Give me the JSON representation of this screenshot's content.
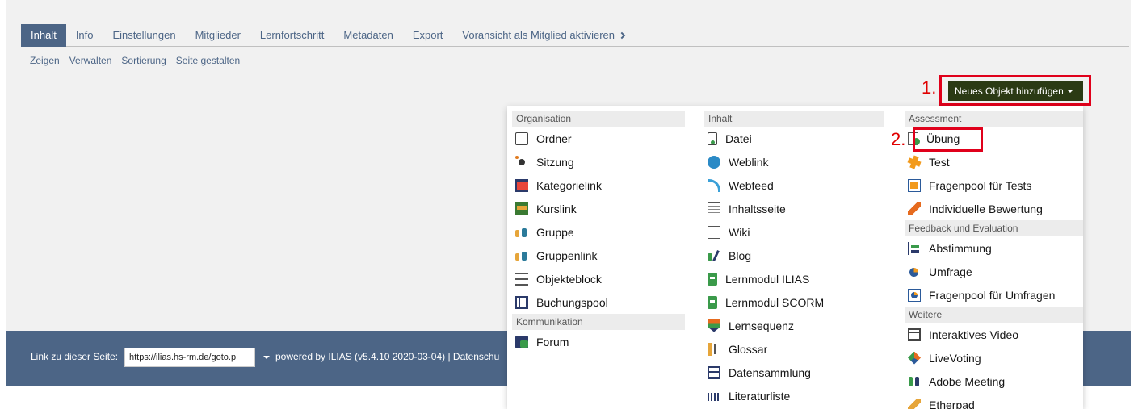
{
  "tabs": [
    {
      "label": "Inhalt",
      "active": true
    },
    {
      "label": "Info"
    },
    {
      "label": "Einstellungen"
    },
    {
      "label": "Mitglieder"
    },
    {
      "label": "Lernfortschritt"
    },
    {
      "label": "Metadaten"
    },
    {
      "label": "Export"
    },
    {
      "label": "Voransicht als Mitglied aktivieren"
    }
  ],
  "subtabs": [
    {
      "label": "Zeigen",
      "active": true
    },
    {
      "label": "Verwalten"
    },
    {
      "label": "Sortierung"
    },
    {
      "label": "Seite gestalten"
    }
  ],
  "markers": {
    "step1": "1.",
    "step2": "2."
  },
  "add_button": {
    "label": "Neues Objekt hinzufügen"
  },
  "footer": {
    "link_label": "Link zu dieser Seite:",
    "link_value": "https://ilias.hs-rm.de/goto.p",
    "powered": "powered by ILIAS (v5.4.10 2020-03-04) | Datenschu"
  },
  "menu": {
    "col1": {
      "organisation": {
        "title": "Organisation",
        "items": [
          {
            "label": "Ordner",
            "icon": "folder-icon"
          },
          {
            "label": "Sitzung",
            "icon": "session-icon"
          },
          {
            "label": "Kategorielink",
            "icon": "category-link-icon"
          },
          {
            "label": "Kurslink",
            "icon": "course-link-icon"
          },
          {
            "label": "Gruppe",
            "icon": "group-icon"
          },
          {
            "label": "Gruppenlink",
            "icon": "group-link-icon"
          },
          {
            "label": "Objekteblock",
            "icon": "object-block-icon"
          },
          {
            "label": "Buchungspool",
            "icon": "booking-pool-icon"
          }
        ]
      },
      "kommunikation": {
        "title": "Kommunikation",
        "items": [
          {
            "label": "Forum",
            "icon": "forum-icon"
          }
        ]
      }
    },
    "col2": {
      "inhalt": {
        "title": "Inhalt",
        "items": [
          {
            "label": "Datei",
            "icon": "file-icon"
          },
          {
            "label": "Weblink",
            "icon": "weblink-icon"
          },
          {
            "label": "Webfeed",
            "icon": "webfeed-icon"
          },
          {
            "label": "Inhaltsseite",
            "icon": "content-page-icon"
          },
          {
            "label": "Wiki",
            "icon": "wiki-icon"
          },
          {
            "label": "Blog",
            "icon": "blog-icon"
          },
          {
            "label": "Lernmodul ILIAS",
            "icon": "learning-module-icon"
          },
          {
            "label": "Lernmodul SCORM",
            "icon": "scorm-module-icon"
          },
          {
            "label": "Lernsequenz",
            "icon": "learning-sequence-icon"
          },
          {
            "label": "Glossar",
            "icon": "glossary-icon"
          },
          {
            "label": "Datensammlung",
            "icon": "data-collection-icon"
          },
          {
            "label": "Literaturliste",
            "icon": "bibliography-icon"
          }
        ]
      }
    },
    "col3": {
      "assessment": {
        "title": "Assessment",
        "items": [
          {
            "label": "Übung",
            "icon": "exercise-icon"
          },
          {
            "label": "Test",
            "icon": "test-icon"
          },
          {
            "label": "Fragenpool für Tests",
            "icon": "question-pool-icon"
          },
          {
            "label": "Individuelle Bewertung",
            "icon": "individual-assessment-icon"
          }
        ]
      },
      "feedback": {
        "title": "Feedback und Evaluation",
        "items": [
          {
            "label": "Abstimmung",
            "icon": "poll-icon"
          },
          {
            "label": "Umfrage",
            "icon": "survey-icon"
          },
          {
            "label": "Fragenpool für Umfragen",
            "icon": "survey-pool-icon"
          }
        ]
      },
      "weitere": {
        "title": "Weitere",
        "items": [
          {
            "label": "Interaktives Video",
            "icon": "interactive-video-icon"
          },
          {
            "label": "LiveVoting",
            "icon": "livevoting-icon"
          },
          {
            "label": "Adobe Meeting",
            "icon": "adobe-meeting-icon"
          },
          {
            "label": "Etherpad",
            "icon": "etherpad-icon"
          }
        ]
      }
    }
  }
}
